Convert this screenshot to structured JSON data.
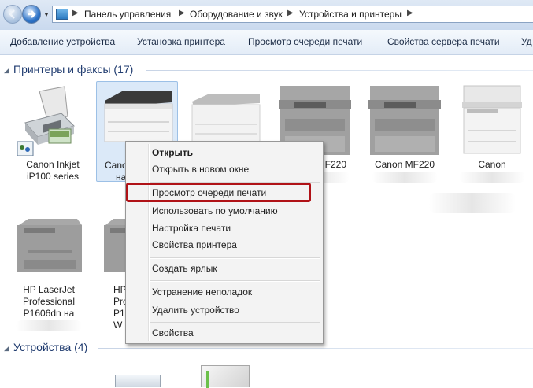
{
  "breadcrumb": [
    "Панель управления",
    "Оборудование и звук",
    "Устройства и принтеры"
  ],
  "toolbar": {
    "add_device": "Добавление устройства",
    "install_printer": "Установка принтера",
    "view_queue": "Просмотр очереди печати",
    "server_props": "Свойства сервера печати",
    "overflow": "Уд"
  },
  "printers_group": {
    "title": "Принтеры и факсы (17)"
  },
  "devices_group": {
    "title": "Устройства (4)"
  },
  "printers": [
    {
      "line1": "Canon Inkjet",
      "line2": "iP100 series"
    },
    {
      "line1": "Cano",
      "line2": "на"
    },
    {
      "line1": "",
      "line2": ""
    },
    {
      "line1": "MF220",
      "line2": ""
    },
    {
      "line1": "Canon MF220",
      "line2": ""
    },
    {
      "line1": "Canon",
      "line2": ""
    },
    {
      "line1": "HP LaserJet",
      "line2": "Professional",
      "line3": "P1606dn на"
    },
    {
      "line1": "HP",
      "line2": "Pro",
      "line3": "P160",
      "line4": "W"
    }
  ],
  "context_menu": {
    "open": "Открыть",
    "open_new": "Открыть в новом окне",
    "view_queue": "Просмотр очереди печати",
    "set_default": "Использовать по умолчанию",
    "print_prefs": "Настройка печати",
    "printer_props": "Свойства принтера",
    "create_shortcut": "Создать ярлык",
    "troubleshoot": "Устранение неполадок",
    "remove": "Удалить устройство",
    "properties": "Свойства"
  },
  "colors": {
    "highlight": "#b01217",
    "accent": "#1e3a6e"
  }
}
